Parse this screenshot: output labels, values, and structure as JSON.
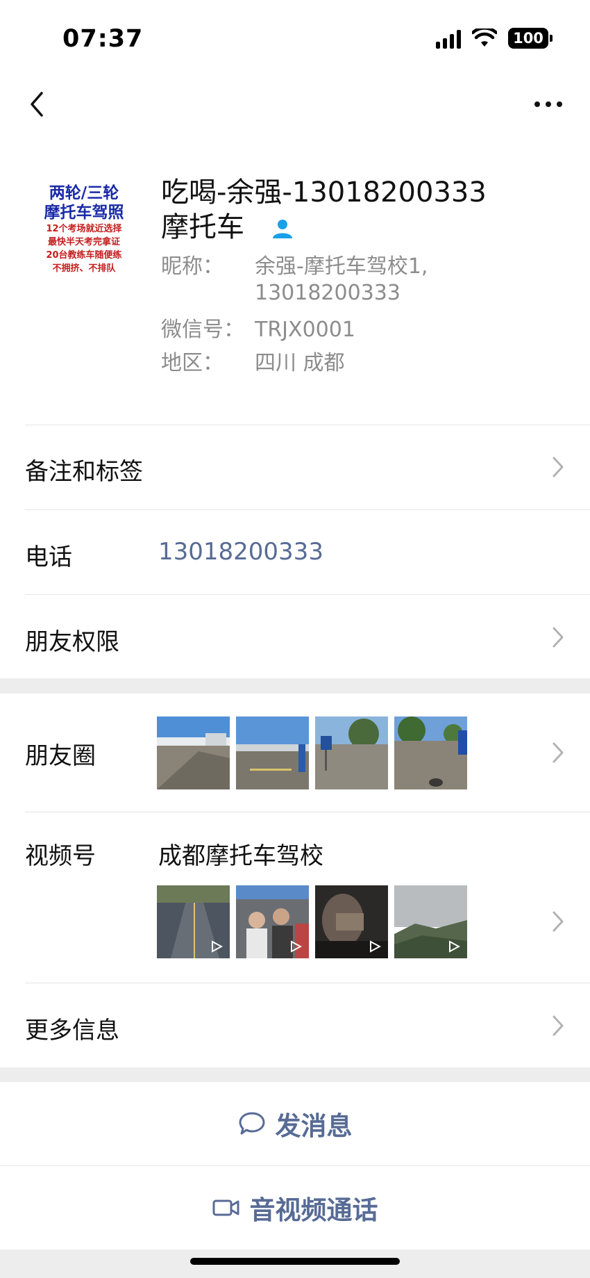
{
  "status": {
    "time": "07:37",
    "battery": "100"
  },
  "nav": {
    "back_icon": "chevron-left-icon",
    "more_icon": "ellipsis-icon"
  },
  "avatar": {
    "line1": "两轮/三轮",
    "line2": "摩托车驾照",
    "line3": "12个考场就近选择",
    "line4": "最快半天考完拿证",
    "line5": "20台教练车随便练",
    "line6": "不拥挤、不排队"
  },
  "profile": {
    "name_line1": "吃喝-余强-13018200333",
    "name_line2": "摩托车",
    "nickname_label": "昵称：",
    "nickname_value_1": "余强-摩托车驾校1,",
    "nickname_value_2": "13018200333",
    "wechat_id_label": "微信号：",
    "wechat_id_value": "TRJX0001",
    "region_label": "地区：",
    "region_value": "四川 成都"
  },
  "rows": {
    "remarks_tags": "备注和标签",
    "phone_label": "电话",
    "phone_value": "13018200333",
    "friend_permissions": "朋友权限",
    "moments": "朋友圈",
    "channels_label": "视频号",
    "channels_name": "成都摩托车驾校",
    "more_info": "更多信息"
  },
  "actions": {
    "send_message": "发消息",
    "video_call": "音视频通话"
  },
  "colors": {
    "link": "#576b95",
    "secondary_text": "#8c8c8c",
    "background": "#ededed"
  }
}
